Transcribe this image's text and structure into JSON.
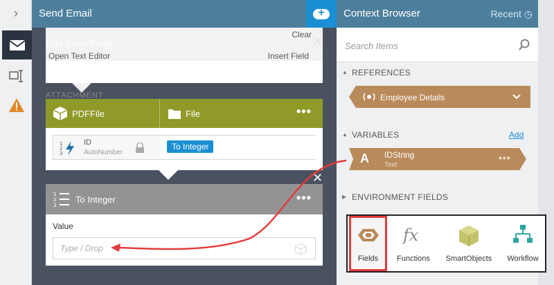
{
  "rail": {
    "items": [
      "chevron-right-icon",
      "mail-icon",
      "form-field-icon",
      "warning-icon"
    ]
  },
  "background_panel": {
    "title": "Send Email",
    "clear_label": "Clear",
    "open_text_editor": "Open Text Editor",
    "insert_field": "Insert Field",
    "attachments": "ATTACHMENT"
  },
  "dialog": {
    "title": "Edit SmartField",
    "source_card": {
      "col1": "PDFFile",
      "col2": "File",
      "field_label": "ID",
      "field_sub": "AutoNumber",
      "chip": "To Integer"
    },
    "function_card": {
      "title": "To Integer",
      "value_label": "Value",
      "placeholder": "Type / Drop"
    }
  },
  "context_browser": {
    "title": "Context Browser",
    "recent": "Recent",
    "search_placeholder": "Search Items",
    "references_header": "REFERENCES",
    "reference_item": "Employee Details",
    "variables_header": "VARIABLES",
    "add_label": "Add",
    "variable_item": {
      "name": "IDString",
      "type": "Text",
      "glyph": "A"
    },
    "environment_header": "ENVIRONMENT FIELDS",
    "toolbar": [
      {
        "label": "Fields",
        "active": true
      },
      {
        "label": "Functions",
        "active": false
      },
      {
        "label": "SmartObjects",
        "active": false
      },
      {
        "label": "Workflow",
        "active": false
      }
    ]
  },
  "colors": {
    "header_blue": "#4d7f9c",
    "accent_blue": "#1b8fd3",
    "olive": "#8f9a29",
    "tan": "#b98a5a",
    "highlight_red": "#e23b3b"
  }
}
